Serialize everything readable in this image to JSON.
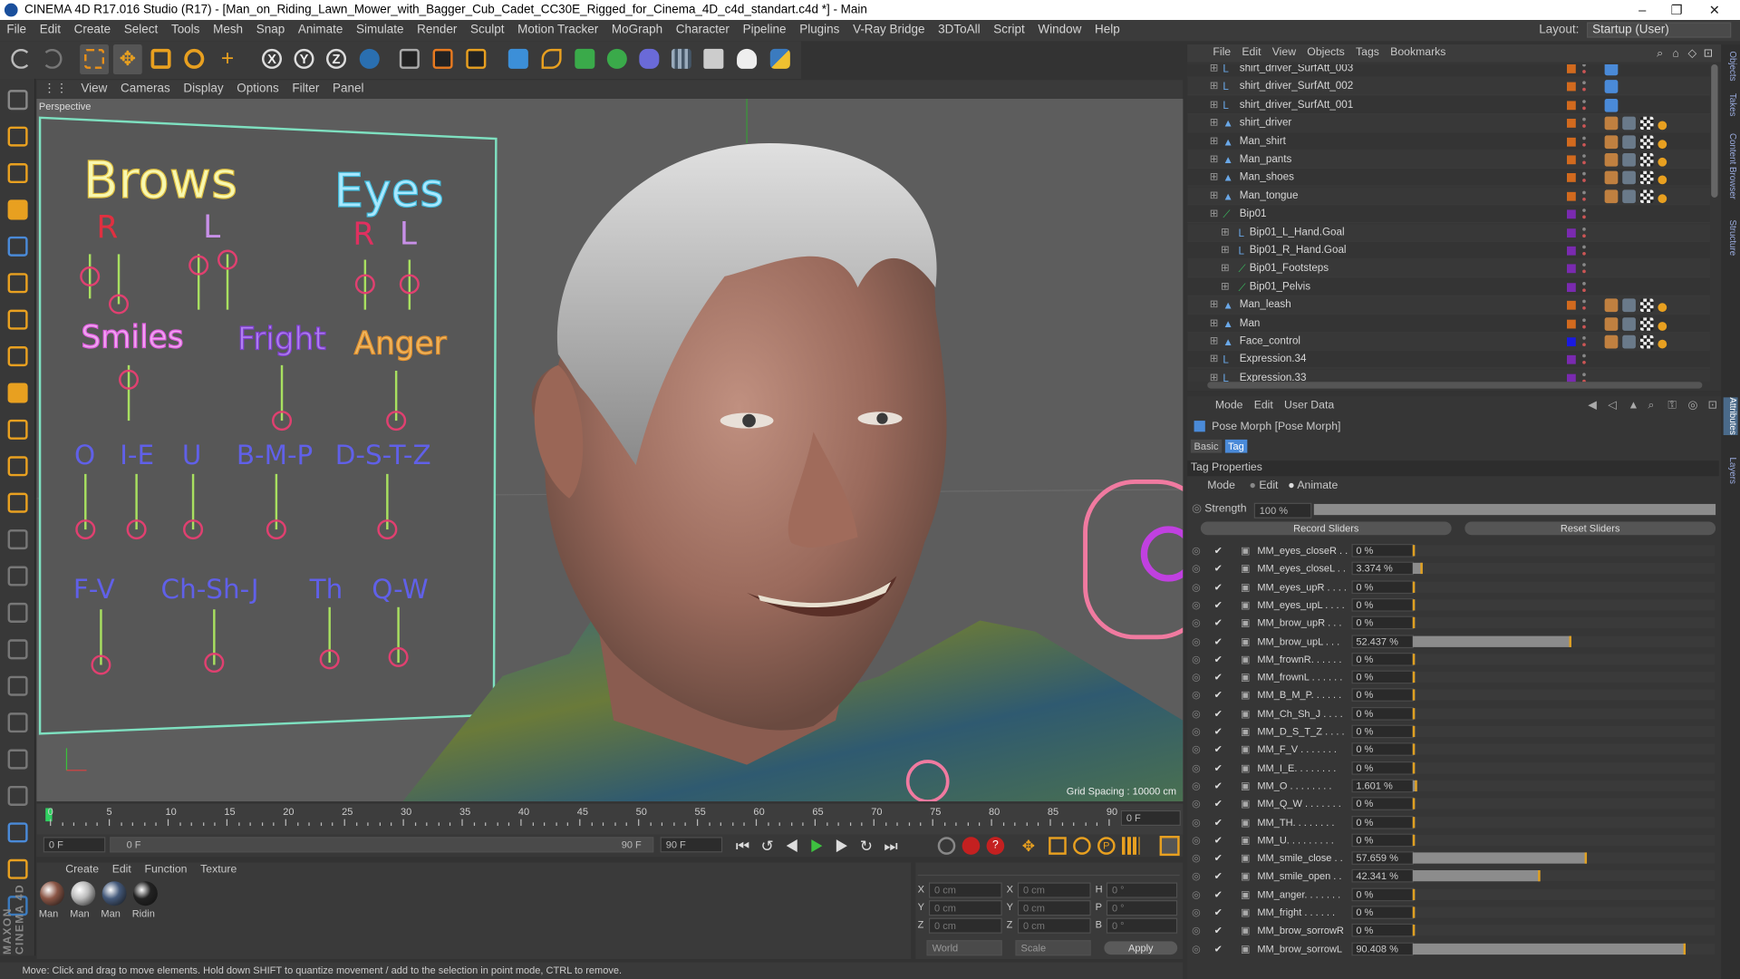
{
  "window": {
    "title": "CINEMA 4D R17.016 Studio (R17) - [Man_on_Riding_Lawn_Mower_with_Bagger_Cub_Cadet_CC30E_Rigged_for_Cinema_4D_c4d_standart.c4d *] - Main",
    "minimize": "–",
    "maximize": "❐",
    "close": "✕"
  },
  "menubar": [
    "File",
    "Edit",
    "Create",
    "Select",
    "Tools",
    "Mesh",
    "Snap",
    "Animate",
    "Simulate",
    "Render",
    "Sculpt",
    "Motion Tracker",
    "MoGraph",
    "Character",
    "Pipeline",
    "Plugins",
    "V-Ray Bridge",
    "3DToAll",
    "Script",
    "Window",
    "Help"
  ],
  "layout": {
    "label": "Layout:",
    "value": "Startup (User)"
  },
  "viewport": {
    "menu": [
      "View",
      "Cameras",
      "Display",
      "Options",
      "Filter",
      "Panel"
    ],
    "label": "Perspective",
    "grid_spacing": "Grid Spacing : 10000 cm",
    "face_panel": {
      "brows": "Brows",
      "eyes": "Eyes",
      "r1": "R",
      "l1": "L",
      "r2": "R",
      "l2": "L",
      "smiles": "Smiles",
      "fright": "Fright",
      "anger": "Anger",
      "o": "O",
      "ie": "I-E",
      "u": "U",
      "bmp": "B-M-P",
      "dstz": "D-S-T-Z",
      "fv": "F-V",
      "chshj": "Ch-Sh-J",
      "th": "Th",
      "qw": "Q-W"
    }
  },
  "timeline": {
    "ticks": [
      "0",
      "5",
      "10",
      "15",
      "20",
      "25",
      "30",
      "35",
      "40",
      "45",
      "50",
      "55",
      "60",
      "65",
      "70",
      "75",
      "80",
      "85",
      "90"
    ],
    "current_frame": "0 F",
    "start": "0 F",
    "range_start": "0 F",
    "range_end": "90 F",
    "end": "90 F"
  },
  "material_manager": {
    "menu": [
      "Create",
      "Edit",
      "Function",
      "Texture"
    ],
    "materials": [
      {
        "label": "Man",
        "color": "#8a5545"
      },
      {
        "label": "Man",
        "color": "#bcbcbc"
      },
      {
        "label": "Man",
        "color": "#44597a"
      },
      {
        "label": "Ridin",
        "color": "#222222"
      }
    ],
    "brand": "MAXON CINEMA 4D"
  },
  "coordinates": {
    "rows": [
      {
        "a": "X",
        "av": "0 cm",
        "b": "X",
        "bv": "0 cm",
        "c": "H",
        "cv": "0 °"
      },
      {
        "a": "Y",
        "av": "0 cm",
        "b": "Y",
        "bv": "0 cm",
        "c": "P",
        "cv": "0 °"
      },
      {
        "a": "Z",
        "av": "0 cm",
        "b": "Z",
        "bv": "0 cm",
        "c": "B",
        "cv": "0 °"
      }
    ],
    "mode1": "World",
    "mode2": "Scale",
    "apply": "Apply"
  },
  "status": "Move: Click and drag to move elements. Hold down SHIFT to quantize movement / add to the selection in point mode, CTRL to remove.",
  "object_manager": {
    "menu": [
      "File",
      "Edit",
      "View",
      "Objects",
      "Tags",
      "Bookmarks"
    ],
    "rows": [
      {
        "name": "shirt_driver_SurfAtt_003",
        "indent": 1,
        "color": "#d26a1e",
        "type": "null"
      },
      {
        "name": "shirt_driver_SurfAtt_002",
        "indent": 1,
        "color": "#d26a1e",
        "type": "null"
      },
      {
        "name": "shirt_driver_SurfAtt_001",
        "indent": 1,
        "color": "#d26a1e",
        "type": "null"
      },
      {
        "name": "shirt_driver",
        "indent": 1,
        "color": "#d26a1e",
        "type": "mesh"
      },
      {
        "name": "Man_shirt",
        "indent": 1,
        "color": "#d26a1e",
        "type": "mesh"
      },
      {
        "name": "Man_pants",
        "indent": 1,
        "color": "#d26a1e",
        "type": "mesh"
      },
      {
        "name": "Man_shoes",
        "indent": 1,
        "color": "#d26a1e",
        "type": "mesh"
      },
      {
        "name": "Man_tongue",
        "indent": 1,
        "color": "#d26a1e",
        "type": "mesh"
      },
      {
        "name": "Bip01",
        "indent": 1,
        "color": "#7a2ab0",
        "type": "bone"
      },
      {
        "name": "Bip01_L_Hand.Goal",
        "indent": 2,
        "color": "#7a2ab0",
        "type": "null"
      },
      {
        "name": "Bip01_R_Hand.Goal",
        "indent": 2,
        "color": "#7a2ab0",
        "type": "null"
      },
      {
        "name": "Bip01_Footsteps",
        "indent": 2,
        "color": "#7a2ab0",
        "type": "bone"
      },
      {
        "name": "Bip01_Pelvis",
        "indent": 2,
        "color": "#7a2ab0",
        "type": "bone"
      },
      {
        "name": "Man_leash",
        "indent": 1,
        "color": "#d26a1e",
        "type": "mesh"
      },
      {
        "name": "Man",
        "indent": 1,
        "color": "#d26a1e",
        "type": "mesh"
      },
      {
        "name": "Face_control",
        "indent": 1,
        "color": "#1a1ae0",
        "type": "mesh"
      },
      {
        "name": "Expression.34",
        "indent": 1,
        "color": "#7a2ab0",
        "type": "null"
      },
      {
        "name": "Expression.33",
        "indent": 1,
        "color": "#7a2ab0",
        "type": "null"
      }
    ]
  },
  "attributes": {
    "menu": [
      "Mode",
      "Edit",
      "User Data"
    ],
    "object_label": "Pose Morph [Pose Morph]",
    "tabs": [
      "Basic",
      "Tag"
    ],
    "section": "Tag Properties",
    "mode_label": "Mode",
    "mode_edit": "Edit",
    "mode_animate": "Animate",
    "strength_label": "Strength",
    "strength_value": "100 %",
    "record_sliders": "Record Sliders",
    "reset_sliders": "Reset Sliders",
    "sliders": [
      {
        "name": "MM_eyes_closeR . .",
        "value": "0 %",
        "level": 0
      },
      {
        "name": "MM_eyes_closeL . .",
        "value": "3.374 %",
        "level": 0.03374
      },
      {
        "name": "MM_eyes_upR . . . .",
        "value": "0 %",
        "level": 0
      },
      {
        "name": "MM_eyes_upL . . . .",
        "value": "0 %",
        "level": 0
      },
      {
        "name": "MM_brow_upR . . .",
        "value": "0 %",
        "level": 0
      },
      {
        "name": "MM_brow_upL . . .",
        "value": "52.437 %",
        "level": 0.52437
      },
      {
        "name": "MM_frownR. . . . . .",
        "value": "0 %",
        "level": 0
      },
      {
        "name": "MM_frownL . . . . . .",
        "value": "0 %",
        "level": 0
      },
      {
        "name": "MM_B_M_P. . . . . .",
        "value": "0 %",
        "level": 0
      },
      {
        "name": "MM_Ch_Sh_J . . . .",
        "value": "0 %",
        "level": 0
      },
      {
        "name": "MM_D_S_T_Z . . . .",
        "value": "0 %",
        "level": 0
      },
      {
        "name": "MM_F_V . . . . . . .",
        "value": "0 %",
        "level": 0
      },
      {
        "name": "MM_I_E. . . . . . . .",
        "value": "0 %",
        "level": 0
      },
      {
        "name": "MM_O . . . . . . . .",
        "value": "1.601 %",
        "level": 0.01601
      },
      {
        "name": "MM_Q_W . . . . . . .",
        "value": "0 %",
        "level": 0
      },
      {
        "name": "MM_TH. . . . . . . .",
        "value": "0 %",
        "level": 0
      },
      {
        "name": "MM_U. . . . . . . . .",
        "value": "0 %",
        "level": 0
      },
      {
        "name": "MM_smile_close . .",
        "value": "57.659 %",
        "level": 0.57659
      },
      {
        "name": "MM_smile_open . .",
        "value": "42.341 %",
        "level": 0.42341
      },
      {
        "name": "MM_anger. . . . . . .",
        "value": "0 %",
        "level": 0
      },
      {
        "name": "MM_fright . . . . . .",
        "value": "0 %",
        "level": 0
      },
      {
        "name": "MM_brow_sorrowR",
        "value": "0 %",
        "level": 0
      },
      {
        "name": "MM_brow_sorrowL",
        "value": "90.408 %",
        "level": 0.90408
      }
    ]
  },
  "side_tabs": [
    "Objects",
    "Takes",
    "Content Browser",
    "Structure",
    "Attributes",
    "Layers"
  ]
}
